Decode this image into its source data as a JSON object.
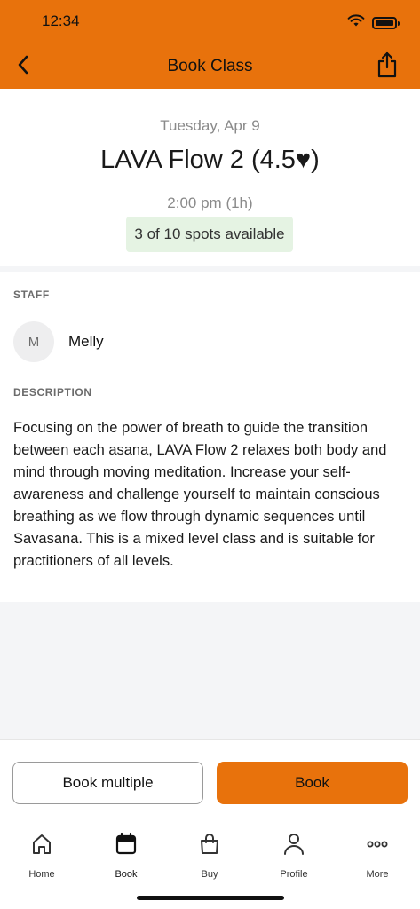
{
  "status_bar": {
    "time": "12:34"
  },
  "nav": {
    "title": "Book Class",
    "back_icon": "chevron-left-icon",
    "share_icon": "share-icon"
  },
  "class": {
    "date": "Tuesday, Apr 9",
    "title": "LAVA Flow 2 (4.5♥)",
    "time": "2:00 pm (1h)",
    "spots": "3 of 10 spots available"
  },
  "staff": {
    "label": "STAFF",
    "avatar_initial": "M",
    "name": "Melly"
  },
  "description": {
    "label": "DESCRIPTION",
    "text": "Focusing on the power of breath to guide the transition between each asana, LAVA Flow 2 relaxes both body and mind through moving meditation. Increase your self-awareness and challenge yourself to maintain conscious breathing as we flow through dynamic sequences until Savasana. This is a mixed level class and is suitable for practitioners of all levels."
  },
  "actions": {
    "book_multiple_label": "Book multiple",
    "book_label": "Book"
  },
  "tabbar": {
    "items": [
      {
        "label": "Home",
        "icon": "home-icon"
      },
      {
        "label": "Book",
        "icon": "calendar-icon",
        "active": true
      },
      {
        "label": "Buy",
        "icon": "shopping-bag-icon"
      },
      {
        "label": "Profile",
        "icon": "person-icon"
      },
      {
        "label": "More",
        "icon": "more-dots-icon"
      }
    ]
  },
  "colors": {
    "brand_orange": "#E8720C",
    "spots_badge_bg": "#e5f3e3",
    "section_gray": "#f4f5f7"
  }
}
